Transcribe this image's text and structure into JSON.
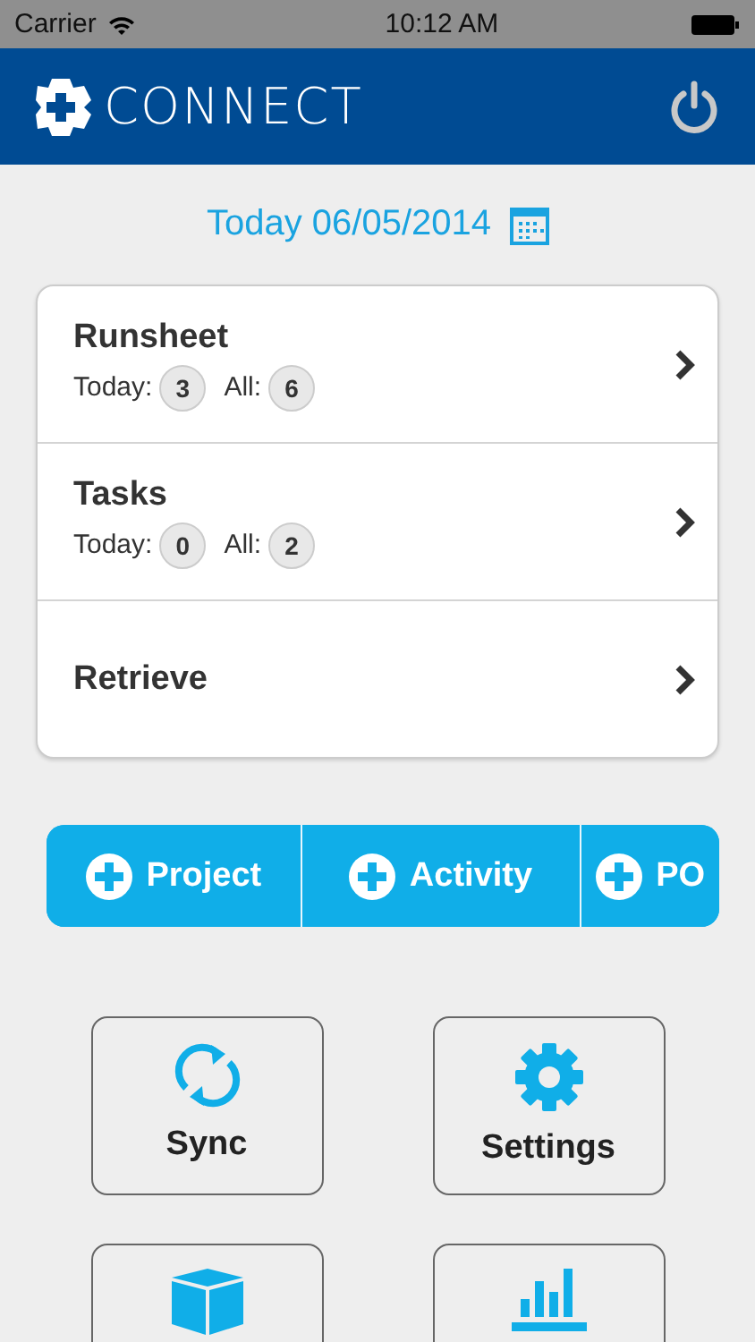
{
  "status_bar": {
    "carrier": "Carrier",
    "time": "10:12 AM"
  },
  "header": {
    "title": "CONNECT"
  },
  "date": {
    "text": "Today 06/05/2014"
  },
  "menu": [
    {
      "title": "Runsheet",
      "today_label": "Today:",
      "today": "3",
      "all_label": "All:",
      "all": "6"
    },
    {
      "title": "Tasks",
      "today_label": "Today:",
      "today": "0",
      "all_label": "All:",
      "all": "2"
    },
    {
      "title": "Retrieve"
    }
  ],
  "quick_add": [
    {
      "label": "Project"
    },
    {
      "label": "Activity"
    },
    {
      "label": "PO"
    }
  ],
  "tiles": [
    {
      "kind": "sync",
      "label": "Sync"
    },
    {
      "kind": "settings",
      "label": "Settings"
    },
    {
      "kind": "box"
    },
    {
      "kind": "chart"
    }
  ]
}
